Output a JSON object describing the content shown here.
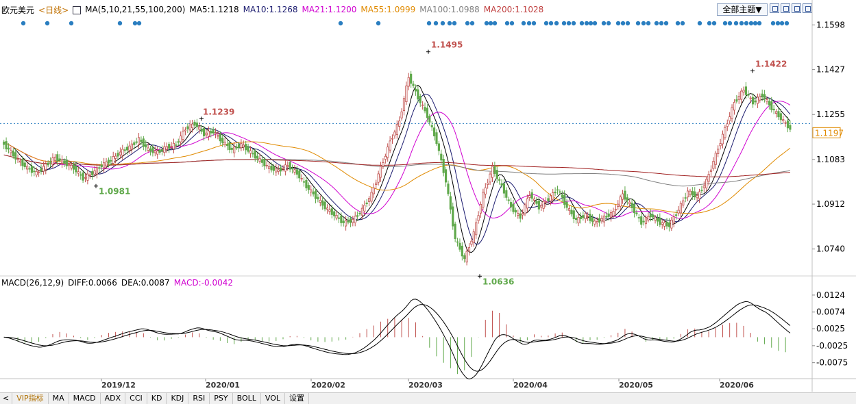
{
  "header": {
    "symbol": "欧元美元",
    "period": "<日线>",
    "ma_label": "MA(5,10,21,55,100,200)",
    "ma5": "MA5:1.1218",
    "ma10": "MA10:1.1268",
    "ma21": "MA21:1.1200",
    "ma55": "MA55:1.0999",
    "ma100": "MA100:1.0988",
    "ma200": "MA200:1.1028",
    "theme_button": "全部主题▼"
  },
  "macd_header": {
    "label": "MACD(26,12,9)",
    "diff": "DIFF:0.0066",
    "dea": "DEA:0.0087",
    "macd": "MACD:-0.0042"
  },
  "tabs": [
    "VIP指标",
    "MA",
    "MACD",
    "ADX",
    "CCI",
    "KD",
    "KDJ",
    "RSI",
    "PSY",
    "BOLL",
    "VOL",
    "设置"
  ],
  "colors": {
    "up": "#c0504d",
    "down": "#5fa84a",
    "ma5": "#000000",
    "ma10": "#1a1a6e",
    "ma21": "#d000d0",
    "ma55": "#e08a00",
    "ma100": "#808080",
    "ma200": "#a02020",
    "dots": "#2a7ec0",
    "dea": "#000000"
  },
  "chart_data": [
    {
      "type": "candlestick",
      "y_ticks": [
        "1.1598",
        "1.1427",
        "1.1255",
        "1.1083",
        "1.0912",
        "1.0740"
      ],
      "ylim": [
        1.065,
        1.162
      ],
      "x_ticks": [
        "2019/12",
        "2020/01",
        "2020/02",
        "2020/03",
        "2020/04",
        "2020/05",
        "2020/06"
      ],
      "current_price": "1.1197",
      "annotations": [
        {
          "text": "1.1495",
          "value": 1.1495,
          "kind": "high"
        },
        {
          "text": "1.1422",
          "value": 1.1422,
          "kind": "high"
        },
        {
          "text": "1.1239",
          "value": 1.1239,
          "kind": "high"
        },
        {
          "text": "1.0981",
          "value": 1.0981,
          "kind": "low"
        },
        {
          "text": "1.0636",
          "value": 1.0636,
          "kind": "low"
        }
      ],
      "close_path": [
        [
          1.115,
          0
        ],
        [
          1.112,
          3
        ],
        [
          1.108,
          7
        ],
        [
          1.105,
          11
        ],
        [
          1.103,
          15
        ],
        [
          1.106,
          19
        ],
        [
          1.109,
          23
        ],
        [
          1.107,
          27
        ],
        [
          1.105,
          31
        ],
        [
          1.101,
          35
        ],
        [
          1.103,
          39
        ],
        [
          1.106,
          43
        ],
        [
          1.108,
          47
        ],
        [
          1.111,
          51
        ],
        [
          1.113,
          55
        ],
        [
          1.116,
          59
        ],
        [
          1.112,
          63
        ],
        [
          1.111,
          67
        ],
        [
          1.113,
          71
        ],
        [
          1.114,
          75
        ],
        [
          1.12,
          79
        ],
        [
          1.122,
          83
        ],
        [
          1.118,
          87
        ],
        [
          1.119,
          91
        ],
        [
          1.115,
          95
        ],
        [
          1.112,
          99
        ],
        [
          1.114,
          103
        ],
        [
          1.111,
          107
        ],
        [
          1.108,
          111
        ],
        [
          1.105,
          115
        ],
        [
          1.104,
          119
        ],
        [
          1.106,
          123
        ],
        [
          1.103,
          127
        ],
        [
          1.098,
          131
        ],
        [
          1.094,
          135
        ],
        [
          1.09,
          139
        ],
        [
          1.087,
          143
        ],
        [
          1.084,
          147
        ],
        [
          1.085,
          151
        ],
        [
          1.089,
          155
        ],
        [
          1.095,
          159
        ],
        [
          1.105,
          163
        ],
        [
          1.115,
          167
        ],
        [
          1.123,
          171
        ],
        [
          1.14,
          175
        ],
        [
          1.132,
          179
        ],
        [
          1.125,
          183
        ],
        [
          1.115,
          187
        ],
        [
          1.1,
          191
        ],
        [
          1.078,
          195
        ],
        [
          1.07,
          199
        ],
        [
          1.08,
          203
        ],
        [
          1.095,
          207
        ],
        [
          1.105,
          211
        ],
        [
          1.098,
          215
        ],
        [
          1.09,
          219
        ],
        [
          1.086,
          223
        ],
        [
          1.095,
          227
        ],
        [
          1.09,
          231
        ],
        [
          1.093,
          235
        ],
        [
          1.097,
          239
        ],
        [
          1.09,
          243
        ],
        [
          1.085,
          247
        ],
        [
          1.087,
          251
        ],
        [
          1.084,
          255
        ],
        [
          1.086,
          259
        ],
        [
          1.088,
          263
        ],
        [
          1.095,
          267
        ],
        [
          1.09,
          271
        ],
        [
          1.084,
          275
        ],
        [
          1.087,
          279
        ],
        [
          1.084,
          283
        ],
        [
          1.083,
          287
        ],
        [
          1.089,
          291
        ],
        [
          1.096,
          295
        ],
        [
          1.094,
          299
        ],
        [
          1.1,
          303
        ],
        [
          1.11,
          307
        ],
        [
          1.12,
          311
        ],
        [
          1.13,
          315
        ],
        [
          1.135,
          319
        ],
        [
          1.13,
          323
        ],
        [
          1.133,
          327
        ],
        [
          1.128,
          331
        ],
        [
          1.124,
          335
        ],
        [
          1.12,
          339
        ]
      ],
      "series": [
        {
          "name": "MA5",
          "value": 1.1218
        },
        {
          "name": "MA10",
          "value": 1.1268
        },
        {
          "name": "MA21",
          "value": 1.12
        },
        {
          "name": "MA55",
          "value": 1.0999
        },
        {
          "name": "MA100",
          "value": 1.0988
        },
        {
          "name": "MA200",
          "value": 1.1028
        }
      ]
    },
    {
      "type": "macd",
      "y_ticks": [
        "0.0124",
        "0.0074",
        "0.0025",
        "-0.0025",
        "-0.0075"
      ],
      "ylim": [
        -0.012,
        0.015
      ],
      "diff": 0.0066,
      "dea": 0.0087,
      "macd": -0.0042
    }
  ]
}
